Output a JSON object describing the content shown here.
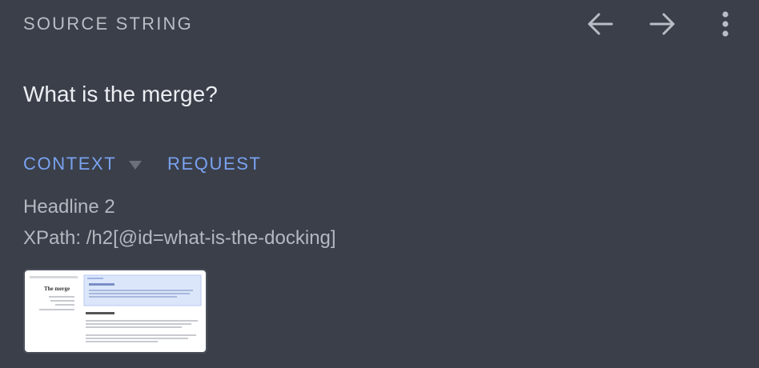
{
  "header": {
    "title": "SOURCE STRING",
    "prev_icon": "arrow-left-icon",
    "next_icon": "arrow-right-icon",
    "more_icon": "more-vertical-icon"
  },
  "source": {
    "text": "What is the merge?"
  },
  "tabs": [
    {
      "label": "CONTEXT"
    },
    {
      "label": "REQUEST"
    }
  ],
  "context": {
    "element_type": "Headline 2",
    "xpath": "XPath: /h2[@id=what-is-the-docking]"
  },
  "screenshot": {
    "page_title": "The merge"
  },
  "colors": {
    "background": "#3a3f4a",
    "accent": "#7aa2f0",
    "muted_text": "#b9bdc5"
  }
}
